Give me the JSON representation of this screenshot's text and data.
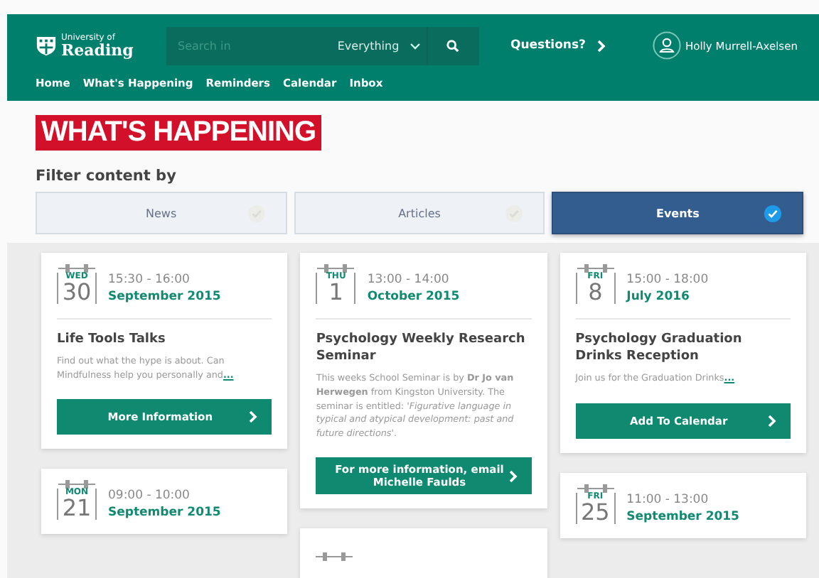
{
  "header": {
    "logo_top": "University of",
    "logo_bottom": "Reading",
    "search": {
      "placeholder": "Search in",
      "scope": "Everything"
    },
    "questions": "Questions?",
    "user": "Holly Murrell-Axelsen"
  },
  "nav": [
    "Home",
    "What's Happening",
    "Reminders",
    "Calendar",
    "Inbox"
  ],
  "title": "WHAT'S HAPPENING",
  "filter_label": "Filter content by",
  "filters": [
    {
      "label": "News",
      "selected": false
    },
    {
      "label": "Articles",
      "selected": false
    },
    {
      "label": "Events",
      "selected": true
    }
  ],
  "events": [
    {
      "weekday": "WED",
      "day": "30",
      "time": "15:30 - 16:00",
      "month": "September 2015",
      "title": "Life Tools Talks",
      "description": "Find out what the hype is about. Can Mindfulness help you personally and",
      "more": "...",
      "action": "More Information"
    },
    {
      "weekday": "THU",
      "day": "1",
      "time": "13:00 - 14:00",
      "month": "October 2015",
      "title": "Psychology Weekly Research Seminar",
      "description": "This weeks School Seminar is by **Dr Jo van Herwegen** from Kingston University. The seminar is entitled: '*Figurative language in typical and atypical development: past and future directions*'.",
      "action": "For more information, email Michelle Faulds"
    },
    {
      "weekday": "FRI",
      "day": "8",
      "time": "15:00 - 18:00",
      "month": "July 2016",
      "title": "Psychology Graduation Drinks Reception",
      "description": "Join us for the Graduation Drinks",
      "more": "...",
      "action": "Add To Calendar"
    },
    {
      "weekday": "MON",
      "day": "21",
      "time": "09:00 - 10:00",
      "month": "September 2015"
    },
    {
      "weekday": "FRI",
      "day": "25",
      "time": "11:00 - 13:00",
      "month": "September 2015"
    }
  ]
}
